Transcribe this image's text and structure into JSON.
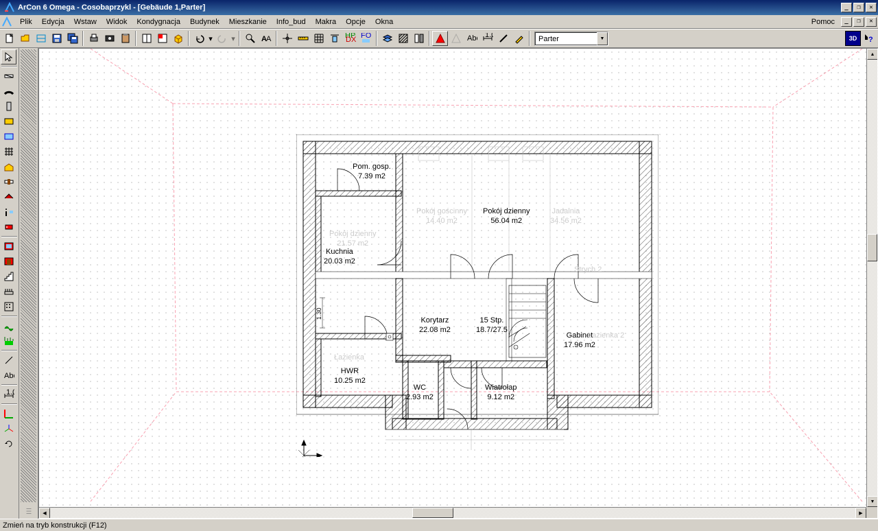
{
  "title": "ArCon 6 Omega - Cosobaprzykl - [Gebäude 1,Parter]",
  "menu": {
    "plik": "Plik",
    "edycja": "Edycja",
    "wstaw": "Wstaw",
    "widok": "Widok",
    "kondygnacja": "Kondygnacja",
    "budynek": "Budynek",
    "mieszkanie": "Mieszkanie",
    "info_bud": "Info_bud",
    "makra": "Makra",
    "opcje": "Opcje",
    "okna": "Okna",
    "pomoc": "Pomoc"
  },
  "toolbar": {
    "floor_select": "Parter",
    "btn_3d": "3D"
  },
  "rooms": {
    "pom_gosp": {
      "name": "Pom. gosp.",
      "area": "7.39 m2"
    },
    "pokoj_dzienny": {
      "name": "Pokój dzienny",
      "area": "56.04 m2"
    },
    "kuchnia": {
      "name": "Kuchnia",
      "area": "20.03 m2"
    },
    "korytarz": {
      "name": "Korytarz",
      "area": "22.08 m2"
    },
    "gabinet": {
      "name": "Gabinet",
      "area": "17.96 m2"
    },
    "hwr": {
      "name": "HWR",
      "area": "10.25 m2"
    },
    "wc": {
      "name": "WC",
      "area": "2.93 m2"
    },
    "wiatrolap": {
      "name": "Wiatrołap",
      "area": "9.12 m2"
    },
    "pokoj_goscinny_ghost": {
      "name": "Pokój gościnny",
      "area": "14.40 m2"
    },
    "jadalnia_ghost": {
      "name": "Jadalnia",
      "area": "34.56 m2"
    },
    "pokoj_dzienny_ghost": {
      "name": "Pokój dzienny",
      "area": "21.57 m2"
    },
    "lazienka_ghost": {
      "name": "Łazienka",
      "area": ""
    },
    "lazienka2_ghost": {
      "name": "Łazienka 2",
      "area": ""
    },
    "strych_ghost": {
      "name": "Strych 2",
      "area": ""
    },
    "stairs": {
      "count": "15 Stp.",
      "dims": "18.7/27.5"
    },
    "dim_1_30": "1.30"
  },
  "status": "Zmień na tryb konstrukcji (F12)"
}
